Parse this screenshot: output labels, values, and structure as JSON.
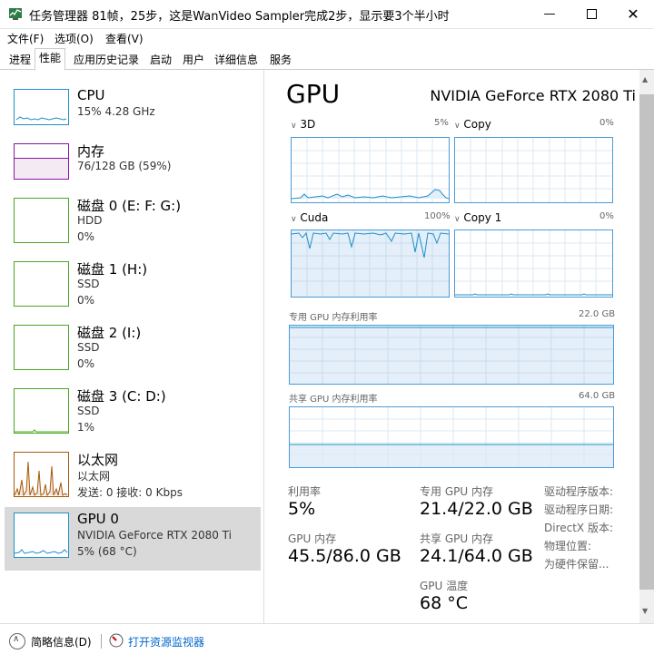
{
  "window": {
    "title": "任务管理器   81帧，25步，这是WanVideo Sampler完成2步，显示要3个半小时",
    "minimize_icon": "minimize-icon",
    "maximize_icon": "maximize-icon",
    "close_icon": "close-icon"
  },
  "menu": [
    "文件(F)",
    "选项(O)",
    "查看(V)"
  ],
  "tabs": [
    "进程",
    "性能",
    "应用历史记录",
    "启动",
    "用户",
    "详细信息",
    "服务"
  ],
  "active_tab": "性能",
  "sidebar": [
    {
      "name": "CPU",
      "line2": "15%  4.28 GHz",
      "line3": "",
      "color": "#1e90c8",
      "usage": 0.15
    },
    {
      "name": "内存",
      "line2": "76/128 GB (59%)",
      "line3": "",
      "color": "#8b14a6",
      "usage": 0.59
    },
    {
      "name": "磁盘 0 (E: F: G:)",
      "line2": "HDD",
      "line3": "0%",
      "color": "#4aa625",
      "usage": 0
    },
    {
      "name": "磁盘 1 (H:)",
      "line2": "SSD",
      "line3": "0%",
      "color": "#4aa625",
      "usage": 0
    },
    {
      "name": "磁盘 2 (I:)",
      "line2": "SSD",
      "line3": "0%",
      "color": "#4aa625",
      "usage": 0
    },
    {
      "name": "磁盘 3 (C: D:)",
      "line2": "SSD",
      "line3": "1%",
      "color": "#4aa625",
      "usage": 0.01
    },
    {
      "name": "以太网",
      "line2": "以太网",
      "line3": "发送: 0  接收: 0 Kbps",
      "color": "#a7590e",
      "usage": 0
    },
    {
      "name": "GPU 0",
      "line2": "NVIDIA GeForce RTX 2080 Ti",
      "line3": "5% (68 °C)",
      "color": "#1e90c8",
      "usage": 0.05
    }
  ],
  "gpu": {
    "heading": "GPU",
    "model": "NVIDIA GeForce RTX 2080 Ti",
    "engines": [
      {
        "label": "3D",
        "pct": "5%"
      },
      {
        "label": "Copy",
        "pct": "0%"
      },
      {
        "label": "Cuda",
        "pct": "100%"
      },
      {
        "label": "Copy 1",
        "pct": "0%"
      }
    ],
    "dedicated_mem_label": "专用 GPU 内存利用率",
    "dedicated_mem_max": "22.0 GB",
    "shared_mem_label": "共享 GPU 内存利用率",
    "shared_mem_max": "64.0 GB",
    "stats": {
      "util_label": "利用率",
      "util_val": "5%",
      "ded_label": "专用 GPU 内存",
      "ded_val": "21.4/22.0 GB",
      "gpumem_label": "GPU 内存",
      "gpumem_val": "45.5/86.0 GB",
      "shared_label": "共享 GPU 内存",
      "shared_val": "24.1/64.0 GB",
      "temp_label": "GPU 温度",
      "temp_val": "68 °C"
    },
    "driver": [
      "驱动程序版本:",
      "驱动程序日期:",
      "DirectX 版本:",
      "物理位置:",
      "为硬件保留..."
    ]
  },
  "footer": {
    "summary": "简略信息(D)",
    "monitor": "打开资源监视器"
  }
}
